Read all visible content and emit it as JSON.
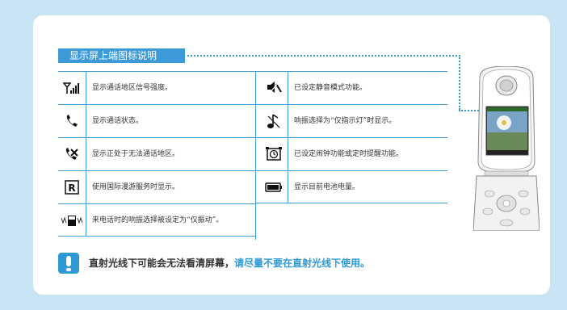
{
  "section_title": "显示屏上端图标说明",
  "left_rows": [
    {
      "icon": "signal-strength-icon",
      "text": "显示通话地区信号强度。"
    },
    {
      "icon": "handset-icon",
      "text": "显示通话状态。"
    },
    {
      "icon": "no-service-handset-icon",
      "text": "显示正处于无法通话地区。"
    },
    {
      "icon": "roaming-r-icon",
      "text": "使用国际漫游服务时显示。"
    },
    {
      "icon": "vibrate-phone-icon",
      "text": "来电话时的响振选择被设定为“仅振动”。"
    }
  ],
  "right_rows": [
    {
      "icon": "silent-mode-icon",
      "text": "已设定静音模式功能。"
    },
    {
      "icon": "music-note-icon",
      "text": "响振选择为“仅指示灯”时显示。"
    },
    {
      "icon": "alarm-clock-icon",
      "text": "已设定闹钟功能或定时提醒功能。"
    },
    {
      "icon": "battery-icon",
      "text": "显示目前电池电量。"
    }
  ],
  "note": {
    "main": "直射光线下可能会无法看清屏幕，",
    "highlight": "请尽量不要在直射光线下使用。"
  },
  "colors": {
    "accent": "#3d9ad8",
    "background": "#c8e3f4"
  }
}
